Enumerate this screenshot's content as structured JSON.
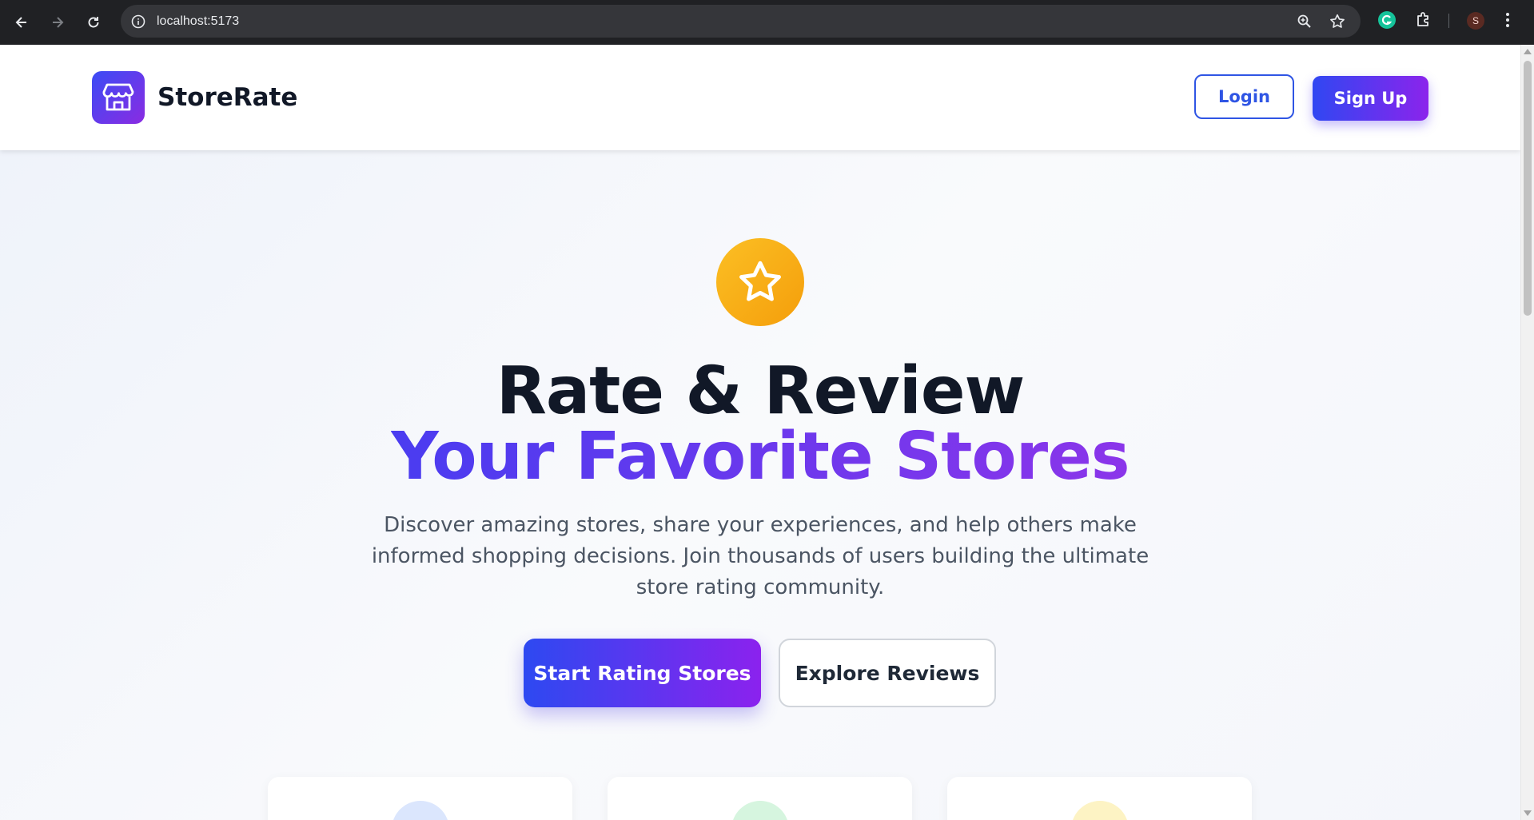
{
  "browser": {
    "url": "localhost:5173",
    "profile_initial": "S"
  },
  "header": {
    "brand": "StoreRate",
    "login_label": "Login",
    "signup_label": "Sign Up"
  },
  "hero": {
    "title_line1": "Rate & Review",
    "title_line2": "Your Favorite Stores",
    "subtitle": "Discover amazing stores, share your experiences, and help others make informed shopping decisions. Join thousands of users building the ultimate store rating community.",
    "primary_cta": "Start Rating Stores",
    "secondary_cta": "Explore Reviews"
  },
  "colors": {
    "brand_gradient_start": "#3047f2",
    "brand_gradient_end": "#8b24ec",
    "star_badge": "#fbbf24",
    "card_circle_1": "#dbe6fd",
    "card_circle_2": "#d6f5df",
    "card_circle_3": "#fdf3c4"
  },
  "icons": {
    "logo": "store-icon",
    "hero_badge": "star-icon"
  }
}
